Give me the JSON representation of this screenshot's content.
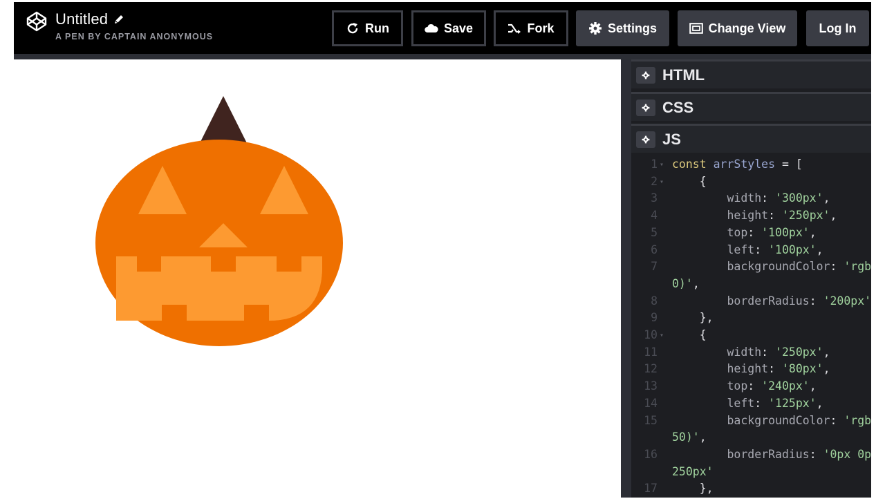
{
  "header": {
    "title": "Untitled",
    "subtitle": "A PEN BY CAPTAIN ANONYMOUS",
    "buttons": {
      "run": "Run",
      "save": "Save",
      "fork": "Fork",
      "settings": "Settings",
      "change_view": "Change View",
      "login": "Log In"
    }
  },
  "editor": {
    "panels": {
      "html": "HTML",
      "css": "CSS",
      "js": "JS"
    },
    "code_lines": [
      {
        "n": "1",
        "fold": true,
        "tokens": [
          [
            "kw",
            "const "
          ],
          [
            "var",
            "arrStyles"
          ],
          [
            "punc",
            " = ["
          ]
        ]
      },
      {
        "n": "2",
        "fold": true,
        "tokens": [
          [
            "punc",
            "    {"
          ]
        ]
      },
      {
        "n": "3",
        "tokens": [
          [
            "prop",
            "        width"
          ],
          [
            "punc",
            ": "
          ],
          [
            "str",
            "'300px'"
          ],
          [
            "punc",
            ","
          ]
        ]
      },
      {
        "n": "4",
        "tokens": [
          [
            "prop",
            "        height"
          ],
          [
            "punc",
            ": "
          ],
          [
            "str",
            "'250px'"
          ],
          [
            "punc",
            ","
          ]
        ]
      },
      {
        "n": "5",
        "tokens": [
          [
            "prop",
            "        top"
          ],
          [
            "punc",
            ": "
          ],
          [
            "str",
            "'100px'"
          ],
          [
            "punc",
            ","
          ]
        ]
      },
      {
        "n": "6",
        "tokens": [
          [
            "prop",
            "        left"
          ],
          [
            "punc",
            ": "
          ],
          [
            "str",
            "'100px'"
          ],
          [
            "punc",
            ","
          ]
        ]
      },
      {
        "n": "7",
        "tokens": [
          [
            "prop",
            "        backgroundColor"
          ],
          [
            "punc",
            ": "
          ],
          [
            "str",
            "'rgb"
          ]
        ]
      },
      {
        "n": "",
        "tokens": [
          [
            "str",
            "0)'"
          ],
          [
            "punc",
            ","
          ]
        ]
      },
      {
        "n": "8",
        "tokens": [
          [
            "prop",
            "        borderRadius"
          ],
          [
            "punc",
            ": "
          ],
          [
            "str",
            "'200px'"
          ]
        ]
      },
      {
        "n": "9",
        "tokens": [
          [
            "punc",
            "    },"
          ]
        ]
      },
      {
        "n": "10",
        "fold": true,
        "tokens": [
          [
            "punc",
            "    {"
          ]
        ]
      },
      {
        "n": "11",
        "tokens": [
          [
            "prop",
            "        width"
          ],
          [
            "punc",
            ": "
          ],
          [
            "str",
            "'250px'"
          ],
          [
            "punc",
            ","
          ]
        ]
      },
      {
        "n": "12",
        "tokens": [
          [
            "prop",
            "        height"
          ],
          [
            "punc",
            ": "
          ],
          [
            "str",
            "'80px'"
          ],
          [
            "punc",
            ","
          ]
        ]
      },
      {
        "n": "13",
        "tokens": [
          [
            "prop",
            "        top"
          ],
          [
            "punc",
            ": "
          ],
          [
            "str",
            "'240px'"
          ],
          [
            "punc",
            ","
          ]
        ]
      },
      {
        "n": "14",
        "tokens": [
          [
            "prop",
            "        left"
          ],
          [
            "punc",
            ": "
          ],
          [
            "str",
            "'125px'"
          ],
          [
            "punc",
            ","
          ]
        ]
      },
      {
        "n": "15",
        "tokens": [
          [
            "prop",
            "        backgroundColor"
          ],
          [
            "punc",
            ": "
          ],
          [
            "str",
            "'rgb"
          ]
        ]
      },
      {
        "n": "",
        "tokens": [
          [
            "str",
            "50)'"
          ],
          [
            "punc",
            ","
          ]
        ]
      },
      {
        "n": "16",
        "tokens": [
          [
            "prop",
            "        borderRadius"
          ],
          [
            "punc",
            ": "
          ],
          [
            "str",
            "'0px 0p"
          ]
        ]
      },
      {
        "n": "",
        "tokens": [
          [
            "str",
            "250px'"
          ]
        ]
      },
      {
        "n": "17",
        "tokens": [
          [
            "punc",
            "    },"
          ]
        ]
      }
    ]
  },
  "preview": {
    "colors": {
      "pumpkin": "#ef7000",
      "features": "#fd9a31",
      "stem": "#40241f"
    }
  }
}
